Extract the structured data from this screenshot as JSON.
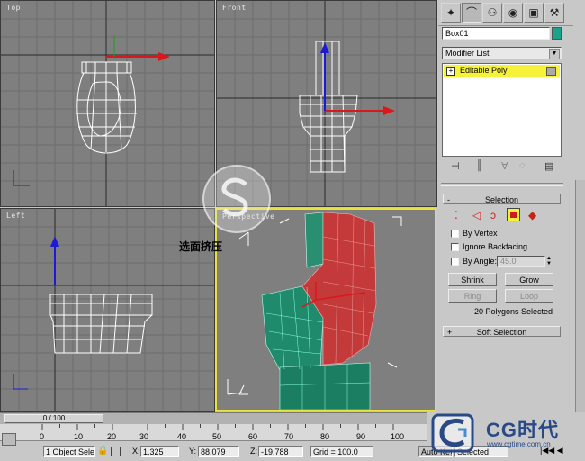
{
  "viewports": {
    "top": {
      "label": "Top"
    },
    "front": {
      "label": "Front"
    },
    "left": {
      "label": "Left"
    },
    "perspective": {
      "label": "Perspective"
    }
  },
  "annotation": "选面挤压",
  "command_panel": {
    "tabs": [
      "create",
      "modify",
      "hierarchy",
      "motion",
      "display",
      "utilities"
    ],
    "object_name": "Box01",
    "object_color": "#1aa38a",
    "modifier_list": "Modifier List",
    "stack_item": "Editable Poly",
    "selection_rollout": {
      "title": "Selection",
      "by_vertex": "By Vertex",
      "ignore_backfacing": "Ignore Backfacing",
      "by_angle": "By Angle:",
      "by_angle_value": "45.0",
      "shrink": "Shrink",
      "grow": "Grow",
      "ring": "Ring",
      "loop": "Loop",
      "status": "20 Polygons Selected"
    },
    "soft_selection_rollout": {
      "title": "Soft Selection"
    }
  },
  "timeline": {
    "slider": "0 / 100",
    "ticks": [
      "0",
      "10",
      "20",
      "30",
      "40",
      "50",
      "60",
      "70",
      "80",
      "90",
      "100"
    ]
  },
  "status_bar": {
    "selection": "1 Object Sele",
    "x_label": "X:",
    "x_value": "1.325",
    "y_label": "Y:",
    "y_value": "88.079",
    "z_label": "Z:",
    "z_value": "-19.788",
    "grid": "Grid = 100.0",
    "auto_key": "Auto Key",
    "selected": "Selected"
  },
  "watermark": {
    "brand": "CG时代",
    "url": "www.cgtime.com.cn"
  },
  "colors": {
    "viewport_bg": "#7f7f7f",
    "selected_face": "#c43a3a",
    "mesh_face": "#1f8a6c",
    "active_border": "#e7e33a",
    "stack_highlight": "#f6f23a"
  }
}
